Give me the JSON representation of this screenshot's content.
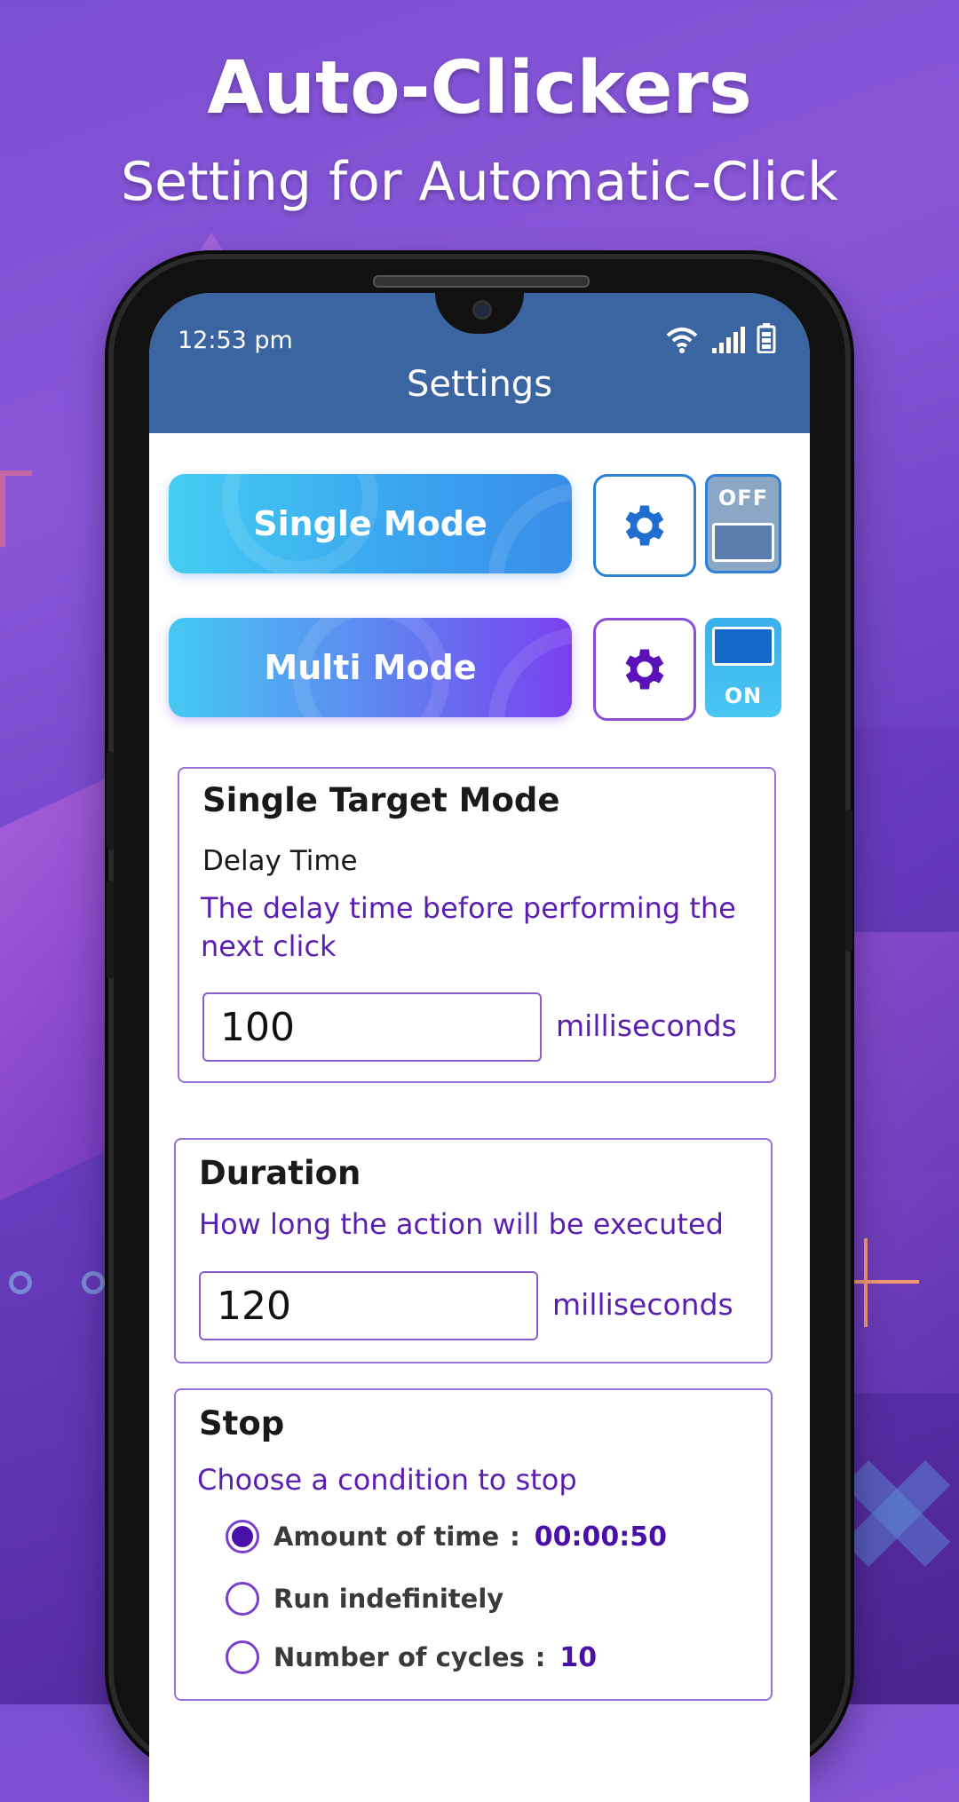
{
  "headline": {
    "title": "Auto-Clickers",
    "subtitle": "Setting for Automatic-Click"
  },
  "status_bar": {
    "time": "12:53 pm",
    "icons": [
      "wifi-icon",
      "signal-icon",
      "battery-icon"
    ]
  },
  "app_bar": {
    "title": "Settings"
  },
  "modes": {
    "single": {
      "label": "Single Mode",
      "toggle_label": "OFF",
      "enabled": false
    },
    "multi": {
      "label": "Multi Mode",
      "toggle_label": "ON",
      "enabled": true
    }
  },
  "single_target": {
    "title": "Single Target Mode",
    "field_label": "Delay Time",
    "description": "The delay time before performing the next click",
    "value": "100",
    "unit": "milliseconds"
  },
  "duration": {
    "title": "Duration",
    "description": "How long the action will be executed",
    "value": "120",
    "unit": "milliseconds"
  },
  "stop": {
    "title": "Stop",
    "description": "Choose a condition to stop",
    "options": [
      {
        "label": "Amount of time",
        "separator": ":",
        "value": "00:00:50",
        "selected": true
      },
      {
        "label": "Run indefinitely",
        "separator": "",
        "value": "",
        "selected": false
      },
      {
        "label": "Number of cycles",
        "separator": ":",
        "value": "10",
        "selected": false
      }
    ]
  },
  "colors": {
    "app_bar": "#3b65a0",
    "accent_purple": "#5a1fb0",
    "accent_blue": "#2e7fd6"
  }
}
